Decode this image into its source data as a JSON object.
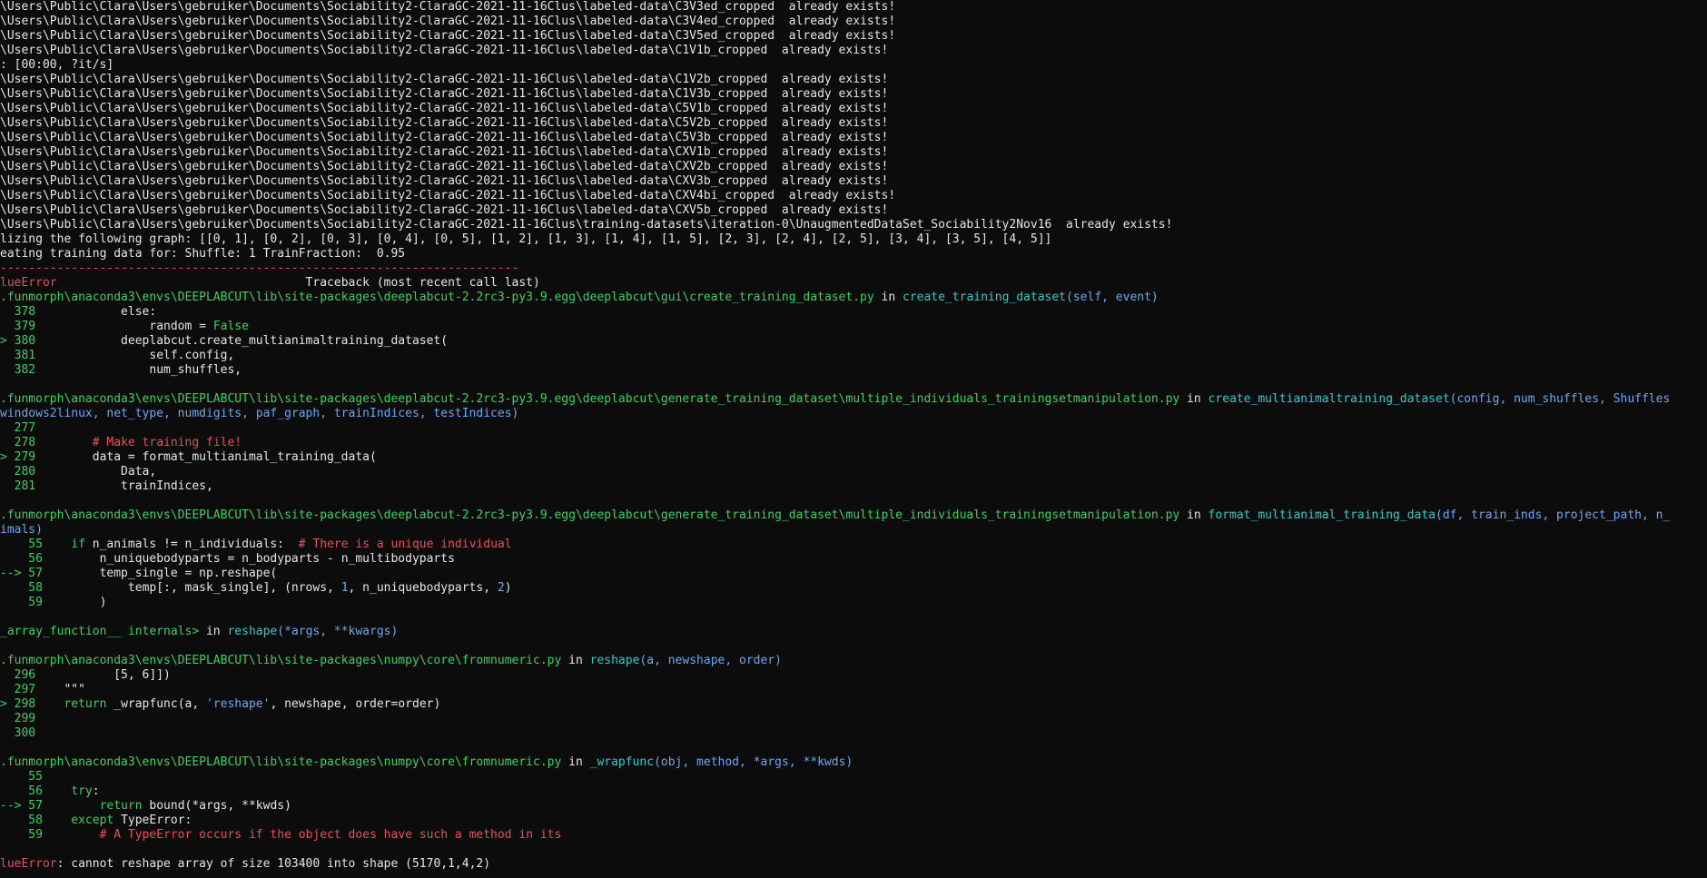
{
  "exists_lines_top": [
    "\\Users\\Public\\Clara\\Users\\gebruiker\\Documents\\Sociability2-ClaraGC-2021-11-16Clus\\labeled-data\\C3V3ed_cropped  already exists!",
    "\\Users\\Public\\Clara\\Users\\gebruiker\\Documents\\Sociability2-ClaraGC-2021-11-16Clus\\labeled-data\\C3V4ed_cropped  already exists!",
    "\\Users\\Public\\Clara\\Users\\gebruiker\\Documents\\Sociability2-ClaraGC-2021-11-16Clus\\labeled-data\\C3V5ed_cropped  already exists!",
    "\\Users\\Public\\Clara\\Users\\gebruiker\\Documents\\Sociability2-ClaraGC-2021-11-16Clus\\labeled-data\\C1V1b_cropped  already exists!"
  ],
  "progress_line": ": [00:00, ?it/s]",
  "exists_lines_bottom": [
    "\\Users\\Public\\Clara\\Users\\gebruiker\\Documents\\Sociability2-ClaraGC-2021-11-16Clus\\labeled-data\\C1V2b_cropped  already exists!",
    "\\Users\\Public\\Clara\\Users\\gebruiker\\Documents\\Sociability2-ClaraGC-2021-11-16Clus\\labeled-data\\C1V3b_cropped  already exists!",
    "\\Users\\Public\\Clara\\Users\\gebruiker\\Documents\\Sociability2-ClaraGC-2021-11-16Clus\\labeled-data\\C5V1b_cropped  already exists!",
    "\\Users\\Public\\Clara\\Users\\gebruiker\\Documents\\Sociability2-ClaraGC-2021-11-16Clus\\labeled-data\\C5V2b_cropped  already exists!",
    "\\Users\\Public\\Clara\\Users\\gebruiker\\Documents\\Sociability2-ClaraGC-2021-11-16Clus\\labeled-data\\C5V3b_cropped  already exists!",
    "\\Users\\Public\\Clara\\Users\\gebruiker\\Documents\\Sociability2-ClaraGC-2021-11-16Clus\\labeled-data\\CXV1b_cropped  already exists!",
    "\\Users\\Public\\Clara\\Users\\gebruiker\\Documents\\Sociability2-ClaraGC-2021-11-16Clus\\labeled-data\\CXV2b_cropped  already exists!",
    "\\Users\\Public\\Clara\\Users\\gebruiker\\Documents\\Sociability2-ClaraGC-2021-11-16Clus\\labeled-data\\CXV3b_cropped  already exists!",
    "\\Users\\Public\\Clara\\Users\\gebruiker\\Documents\\Sociability2-ClaraGC-2021-11-16Clus\\labeled-data\\CXV4bi_cropped  already exists!",
    "\\Users\\Public\\Clara\\Users\\gebruiker\\Documents\\Sociability2-ClaraGC-2021-11-16Clus\\labeled-data\\CXV5b_cropped  already exists!",
    "\\Users\\Public\\Clara\\Users\\gebruiker\\Documents\\Sociability2-ClaraGC-2021-11-16Clus\\training-datasets\\iteration-0\\UnaugmentedDataSet_Sociability2Nov16  already exists!"
  ],
  "graph_line": "lizing the following graph: [[0, 1], [0, 2], [0, 3], [0, 4], [0, 5], [1, 2], [1, 3], [1, 4], [1, 5], [2, 3], [2, 4], [2, 5], [3, 4], [3, 5], [4, 5]]",
  "creating_line": "eating training data for: Shuffle: 1 TrainFraction:  0.95",
  "separator": "-------------------------------------------------------------------------",
  "error_header": {
    "name": "lueError",
    "traceback": "                                   Traceback (most recent call last)"
  },
  "frame1": {
    "path": ".funmorph\\anaconda3\\envs\\DEEPLABCUT\\lib\\site-packages\\deeplabcut-2.2rc3-py3.9.egg\\deeplabcut\\gui\\create_training_dataset.py",
    "in_kw": " in ",
    "func": "create_training_dataset",
    "args": "(self, event)",
    "lines": [
      {
        "num": "  378",
        "code": "            else:"
      },
      {
        "num": "  379",
        "code": "                random = ",
        "kw": "False"
      },
      {
        "num": "> 380",
        "code": "            deeplabcut.create_multianimaltraining_dataset("
      },
      {
        "num": "  381",
        "code": "                self.config,"
      },
      {
        "num": "  382",
        "code": "                num_shuffles,"
      }
    ]
  },
  "frame2": {
    "path": ".funmorph\\anaconda3\\envs\\DEEPLABCUT\\lib\\site-packages\\deeplabcut-2.2rc3-py3.9.egg\\deeplabcut\\generate_training_dataset\\multiple_individuals_trainingsetmanipulation.py",
    "in_kw": " in ",
    "func": "create_multianimaltraining_dataset",
    "args": "(config, num_shuffles, Shuffles",
    "args_cont": "windows2linux, net_type, numdigits, paf_graph, trainIndices, testIndices)",
    "lines": [
      {
        "num": "  277",
        "code": ""
      },
      {
        "num": "  278",
        "code": "        ",
        "comment": "# Make training file!"
      },
      {
        "num": "> 279",
        "code": "        data = format_multianimal_training_data("
      },
      {
        "num": "  280",
        "code": "            Data,"
      },
      {
        "num": "  281",
        "code": "            trainIndices,"
      }
    ]
  },
  "frame3": {
    "path": ".funmorph\\anaconda3\\envs\\DEEPLABCUT\\lib\\site-packages\\deeplabcut-2.2rc3-py3.9.egg\\deeplabcut\\generate_training_dataset\\multiple_individuals_trainingsetmanipulation.py",
    "in_kw": " in ",
    "func": "format_multianimal_training_data",
    "args": "(df, train_inds, project_path, n_",
    "args_cont": "imals)",
    "lines": [
      {
        "num": "    55",
        "code": "    ",
        "kw": "if",
        "rest": " n_animals != n_individuals:  ",
        "comment": "# There is a unique individual"
      },
      {
        "num": "    56",
        "code": "        n_uniquebodyparts = n_bodyparts - n_multibodyparts"
      },
      {
        "num": "--> 57",
        "code": "        temp_single = np.reshape("
      },
      {
        "num": "    58",
        "code": "            temp[:, mask_single], (nrows, ",
        "num_lit": "1",
        "rest2": ", n_uniquebodyparts, ",
        "num_lit2": "2",
        "rest3": ")"
      },
      {
        "num": "    59",
        "code": "        )"
      }
    ]
  },
  "frame4": {
    "path": "_array_function__ internals>",
    "in_kw": " in ",
    "func": "reshape",
    "args": "(*args, **kwargs)"
  },
  "frame5": {
    "path": ".funmorph\\anaconda3\\envs\\DEEPLABCUT\\lib\\site-packages\\numpy\\core\\fromnumeric.py",
    "in_kw": " in ",
    "func": "reshape",
    "args": "(a, newshape, order)",
    "lines": [
      {
        "num": "  296",
        "code": "           [5, 6]])"
      },
      {
        "num": "  297",
        "code": "    \"\"\""
      },
      {
        "num": "> 298",
        "code": "    ",
        "kw": "return",
        "rest": " _wrapfunc(a, ",
        "str": "'reshape'",
        "rest2": ", newshape, order=order)"
      },
      {
        "num": "  299",
        "code": ""
      },
      {
        "num": "  300",
        "code": ""
      }
    ]
  },
  "frame6": {
    "path": ".funmorph\\anaconda3\\envs\\DEEPLABCUT\\lib\\site-packages\\numpy\\core\\fromnumeric.py",
    "in_kw": " in ",
    "func": "_wrapfunc",
    "args": "(obj, method, *args, **kwds)",
    "lines": [
      {
        "num": "    55",
        "code": ""
      },
      {
        "num": "    56",
        "code": "    ",
        "kw": "try",
        "rest": ":"
      },
      {
        "num": "--> 57",
        "code": "        ",
        "kw": "return",
        "rest": " bound(*args, **kwds)"
      },
      {
        "num": "    58",
        "code": "    ",
        "kw": "except",
        "rest": " TypeError:"
      },
      {
        "num": "    59",
        "code": "        ",
        "comment": "# A TypeError occurs if the object does have such a method in its"
      }
    ]
  },
  "final_error": {
    "name": "lueError",
    "message": ": cannot reshape array of size 103400 into shape (5170,1,4,2)"
  },
  "colors": {
    "background": "#0c0c0c",
    "text": "#cccccc",
    "green": "#3cd160",
    "cyan": "#3ac7c9",
    "blue": "#6ba7f0",
    "red": "#e8505b"
  }
}
